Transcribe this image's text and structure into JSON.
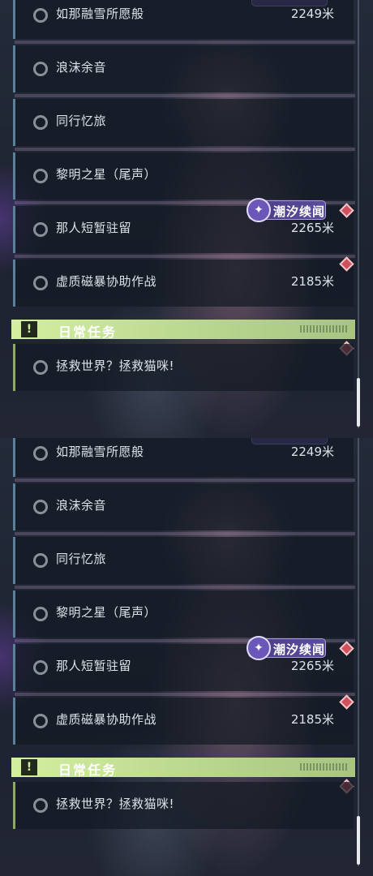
{
  "quests": [
    {
      "label": "如那融雪所愿般",
      "distance": "2249米"
    },
    {
      "label": "浪沫余音",
      "distance": ""
    },
    {
      "label": "同行忆旅",
      "distance": ""
    },
    {
      "label": "黎明之星（尾声）",
      "distance": ""
    },
    {
      "label": "那人短暂驻留",
      "distance": "2265米"
    },
    {
      "label": "虚质磁暴协助作战",
      "distance": "2185米"
    }
  ],
  "tide_badge": {
    "label": "潮汐续闻",
    "icon": "sparkle-icon"
  },
  "daily": {
    "title": "日常任务",
    "icon": "exclamation-icon",
    "quests": [
      {
        "label": "拯救世界？拯救猫咪!",
        "distance": ""
      }
    ]
  },
  "colors": {
    "row_accent": "#5e7f98",
    "daily_accent": "#d3ef9f",
    "marker": "#d2505e",
    "tide_badge": "#4a3c86"
  }
}
